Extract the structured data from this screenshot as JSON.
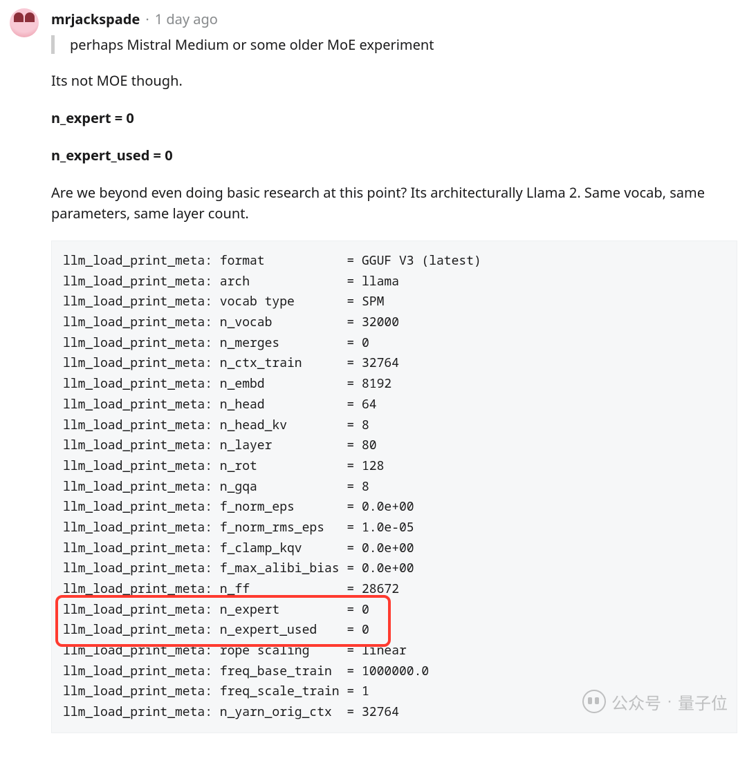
{
  "comment": {
    "author": "mrjackspade",
    "time": "1 day ago",
    "quote": "perhaps Mistral Medium or some older MoE experiment",
    "body_line1": "Its not MOE though.",
    "expert_line1": "n_expert = 0",
    "expert_line2": "n_expert_used = 0",
    "body_line2": "Are we beyond even doing basic research at this point? Its architecturally Llama 2. Same vocab, same parameters, same layer count.",
    "separator": "·"
  },
  "code": {
    "prefix": "llm_load_print_meta:",
    "rows": [
      {
        "key": "format",
        "val": "GGUF V3 (latest)"
      },
      {
        "key": "arch",
        "val": "llama"
      },
      {
        "key": "vocab type",
        "val": "SPM"
      },
      {
        "key": "n_vocab",
        "val": "32000"
      },
      {
        "key": "n_merges",
        "val": "0"
      },
      {
        "key": "n_ctx_train",
        "val": "32764"
      },
      {
        "key": "n_embd",
        "val": "8192"
      },
      {
        "key": "n_head",
        "val": "64"
      },
      {
        "key": "n_head_kv",
        "val": "8"
      },
      {
        "key": "n_layer",
        "val": "80"
      },
      {
        "key": "n_rot",
        "val": "128"
      },
      {
        "key": "n_gqa",
        "val": "8"
      },
      {
        "key": "f_norm_eps",
        "val": "0.0e+00"
      },
      {
        "key": "f_norm_rms_eps",
        "val": "1.0e-05"
      },
      {
        "key": "f_clamp_kqv",
        "val": "0.0e+00"
      },
      {
        "key": "f_max_alibi_bias",
        "val": "0.0e+00"
      },
      {
        "key": "n_ff",
        "val": "28672"
      },
      {
        "key": "n_expert",
        "val": "0"
      },
      {
        "key": "n_expert_used",
        "val": "0"
      },
      {
        "key": "rope scaling",
        "val": "linear"
      },
      {
        "key": "freq_base_train",
        "val": "1000000.0"
      },
      {
        "key": "freq_scale_train",
        "val": "1"
      },
      {
        "key": "n_yarn_orig_ctx",
        "val": "32764"
      }
    ],
    "key_width": 16,
    "highlight_rows": [
      17,
      18
    ]
  },
  "watermark": {
    "label": "公众号",
    "sep": "·",
    "name": "量子位"
  }
}
